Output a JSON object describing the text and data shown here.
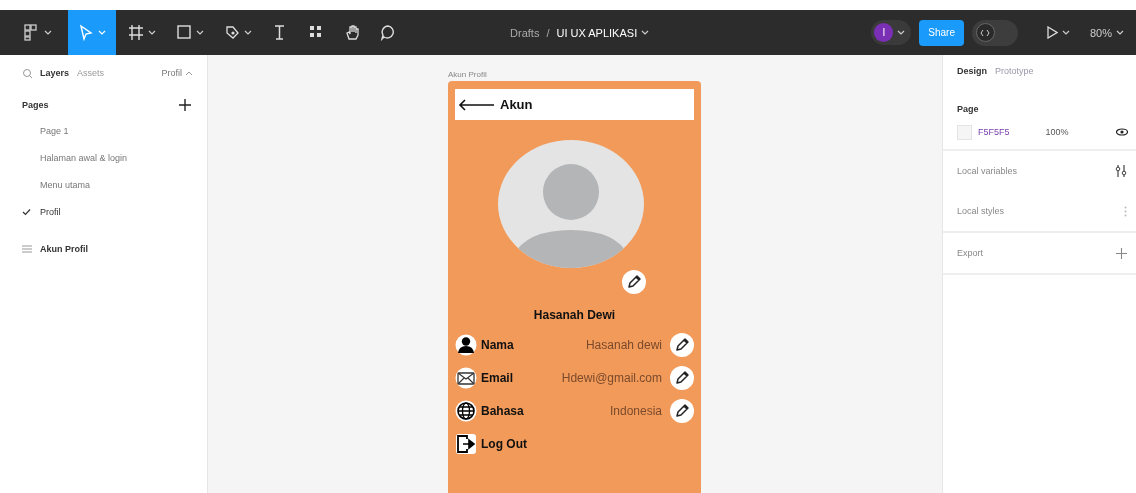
{
  "toolbar": {
    "tools": [
      {
        "kind": "menu",
        "selected": false,
        "caret": true
      },
      {
        "kind": "move",
        "selected": true,
        "caret": true
      },
      {
        "kind": "frame",
        "selected": false,
        "caret": true
      },
      {
        "kind": "shape",
        "selected": false,
        "caret": true
      },
      {
        "kind": "pen",
        "selected": false,
        "caret": true
      },
      {
        "kind": "text",
        "selected": false,
        "caret": false
      },
      {
        "kind": "resources",
        "selected": false,
        "caret": false
      },
      {
        "kind": "hand",
        "selected": false,
        "caret": false
      },
      {
        "kind": "comment",
        "selected": false,
        "caret": false
      }
    ],
    "location": "Drafts",
    "separator": "/",
    "file_name": "UI UX APLIKASI",
    "avatar": "I",
    "share": "Share",
    "dev_mode": false,
    "zoom": "80%"
  },
  "left_panel": {
    "tabs": [
      {
        "label": "Layers",
        "selected": true
      },
      {
        "label": "Assets",
        "selected": false
      }
    ],
    "page_picker": "Profil",
    "pages_heading": "Pages",
    "pages": [
      {
        "label": "Page 1",
        "selected": false
      },
      {
        "label": "Halaman awal & login",
        "selected": false
      },
      {
        "label": "Menu utama",
        "selected": false
      },
      {
        "label": "Profil",
        "selected": true
      }
    ],
    "layers": [
      {
        "label": "Akun Profil"
      }
    ]
  },
  "canvas": {
    "frame_label": "Akun Profil",
    "header_title": "Akun",
    "user_name": "Hasanah Dewi",
    "rows": [
      {
        "kind": "person",
        "label": "Nama",
        "value": "Hasanah dewi",
        "editable": true
      },
      {
        "kind": "mail",
        "label": "Email",
        "value": "Hdewi@gmail.com",
        "editable": true
      },
      {
        "kind": "globe",
        "label": "Bahasa",
        "value": "Indonesia",
        "editable": true
      },
      {
        "kind": "logout",
        "label": "Log Out",
        "editable": false
      }
    ]
  },
  "right_panel": {
    "tabs": [
      {
        "label": "Design",
        "selected": true
      },
      {
        "label": "Prototype",
        "selected": false
      }
    ],
    "page_heading": "Page",
    "background_hex": "F5F5F5",
    "background_opacity": "100%",
    "sections": [
      {
        "kind": "variables",
        "label": "Local variables"
      },
      {
        "kind": "styles",
        "label": "Local styles"
      },
      {
        "kind": "export",
        "label": "Export"
      }
    ]
  }
}
